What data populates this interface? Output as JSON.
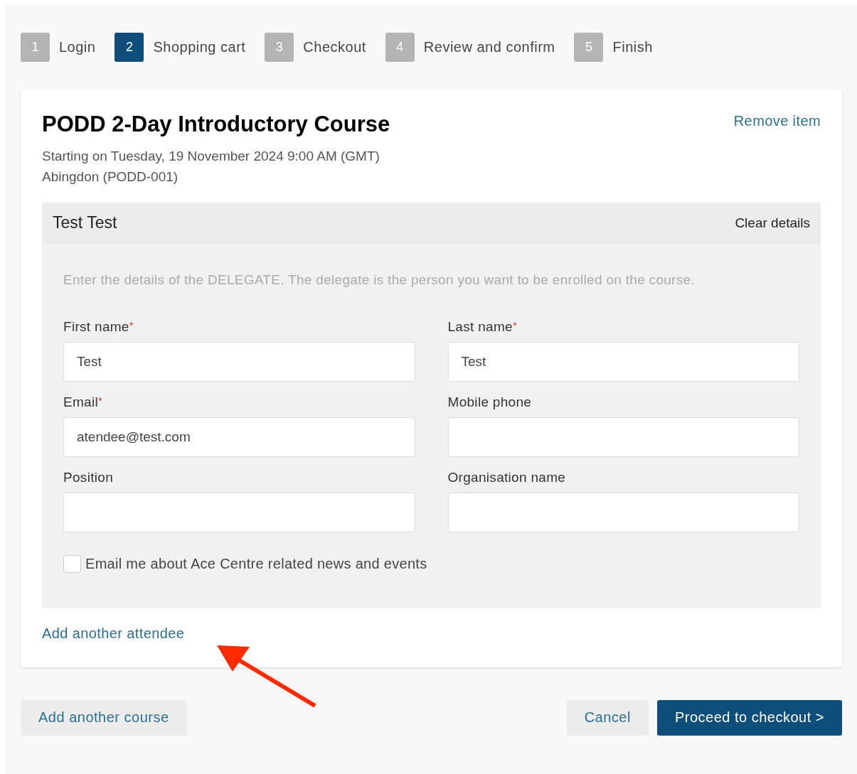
{
  "steps": [
    {
      "number": "1",
      "label": "Login",
      "selected": false
    },
    {
      "number": "2",
      "label": "Shopping cart",
      "selected": true
    },
    {
      "number": "3",
      "label": "Checkout",
      "selected": false
    },
    {
      "number": "4",
      "label": "Review and confirm",
      "selected": false
    },
    {
      "number": "5",
      "label": "Finish",
      "selected": false
    }
  ],
  "course": {
    "title": "PODD 2-Day Introductory Course",
    "remove_link": "Remove item",
    "date": "Starting on Tuesday, 19 November 2024 9:00 AM (GMT)",
    "location": "Abingdon (PODD-001)"
  },
  "delegate": {
    "name": "Test Test",
    "clear_link": "Clear details",
    "instructions": "Enter the details of the DELEGATE. The delegate is the person you want to be enrolled on the course.",
    "fields": [
      {
        "label": "First name",
        "required_mark": "*",
        "value": "Test"
      },
      {
        "label": "Last name",
        "required_mark": "*",
        "value": "Test"
      },
      {
        "label": "Email",
        "required_mark": "*",
        "value": "atendee@test.com"
      },
      {
        "label": "Mobile phone"
      },
      {
        "label": "Position"
      },
      {
        "label": "Organisation name"
      }
    ],
    "newsletter": {
      "label": "Email me about Ace Centre related news and events",
      "checked": false
    }
  },
  "add_attendee_link": "Add another attendee",
  "buttons": {
    "add_course": "Add another course",
    "cancel": "Cancel",
    "proceed": "Proceed to checkout >"
  }
}
